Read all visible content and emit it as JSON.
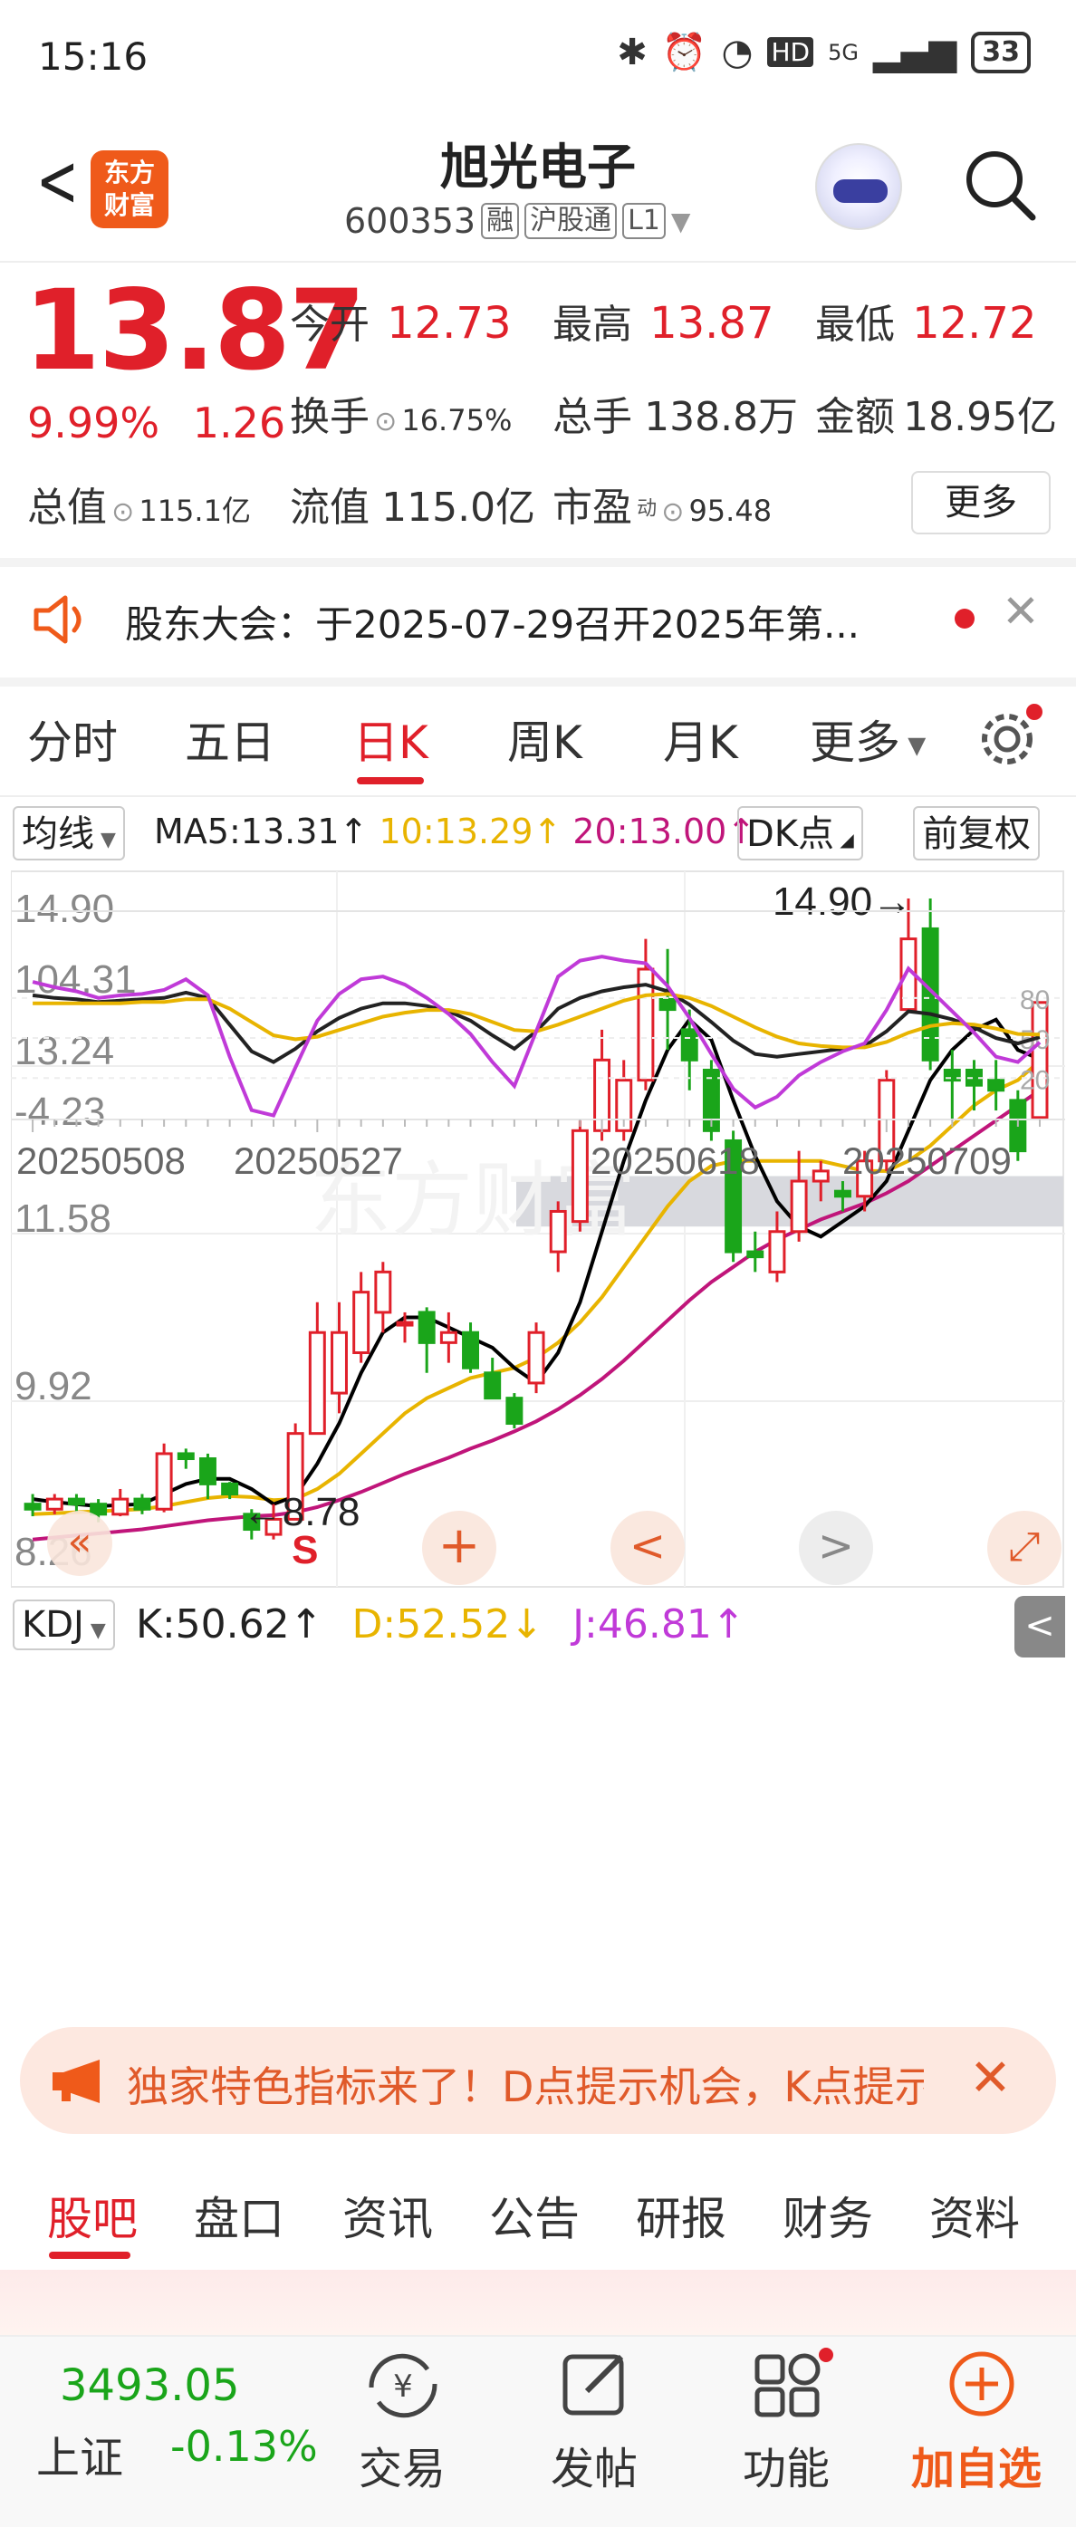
{
  "status": {
    "time": "15:16",
    "network": "5G",
    "hd": "HD",
    "battery": "33"
  },
  "header": {
    "title": "旭光电子",
    "code": "600353",
    "tags": [
      "融",
      "沪股通",
      "L1"
    ],
    "logo_lines": [
      "东方",
      "财富"
    ]
  },
  "quote": {
    "price": "13.87",
    "pct": "9.99%",
    "change": "1.26",
    "open_label": "今开",
    "open": "12.73",
    "high_label": "最高",
    "high": "13.87",
    "low_label": "最低",
    "low": "12.72",
    "turnover_label": "换手",
    "turnover": "16.75%",
    "volume_label": "总手",
    "volume": "138.8万",
    "amount_label": "金额",
    "amount": "18.95亿",
    "mktcap_label": "总值",
    "mktcap": "115.1亿",
    "float_label": "流值",
    "float": "115.0亿",
    "pe_label": "市盈",
    "pe_sup": "动",
    "pe": "95.48",
    "more": "更多"
  },
  "notice": {
    "text": "股东大会：于2025-07-29召开2025年第..."
  },
  "tabs": [
    "分时",
    "五日",
    "日K",
    "周K",
    "月K",
    "更多"
  ],
  "active_tab": "日K",
  "kline_bar": {
    "ma_btn": "均线",
    "ma5": "MA5:13.31↑",
    "ma10": "10:13.29↑",
    "ma20": "20:13.00↑",
    "dk": "DK点",
    "fq": "前复权"
  },
  "kdj_bar": {
    "btn": "KDJ",
    "k": "K:50.62↑",
    "d": "D:52.52↓",
    "j": "J:46.81↑"
  },
  "chart_data": [
    {
      "type": "candlestick",
      "y_labels": [
        "14.90",
        "13.24",
        "11.58",
        "9.92",
        "8.26"
      ],
      "ylim": [
        8.26,
        14.9
      ],
      "annotations": [
        "14.90",
        "8.78",
        "S"
      ],
      "x_labels": [
        "20250508",
        "20250527",
        "20250618",
        "20250709"
      ],
      "candles": [
        {
          "o": 8.9,
          "c": 8.85,
          "h": 9.0,
          "l": 8.78
        },
        {
          "o": 8.85,
          "c": 8.95,
          "h": 9.0,
          "l": 8.8
        },
        {
          "o": 8.95,
          "c": 8.9,
          "h": 9.0,
          "l": 8.82
        },
        {
          "o": 8.9,
          "c": 8.8,
          "h": 8.95,
          "l": 8.72
        },
        {
          "o": 8.8,
          "c": 8.95,
          "h": 9.05,
          "l": 8.78
        },
        {
          "o": 8.95,
          "c": 8.85,
          "h": 9.0,
          "l": 8.8
        },
        {
          "o": 8.85,
          "c": 9.4,
          "h": 9.5,
          "l": 8.82
        },
        {
          "o": 9.4,
          "c": 9.35,
          "h": 9.45,
          "l": 9.25
        },
        {
          "o": 9.35,
          "c": 9.1,
          "h": 9.4,
          "l": 8.95
        },
        {
          "o": 9.1,
          "c": 9.0,
          "h": 9.12,
          "l": 8.95
        },
        {
          "o": 8.8,
          "c": 8.65,
          "h": 8.85,
          "l": 8.55
        },
        {
          "o": 8.6,
          "c": 8.75,
          "h": 8.9,
          "l": 8.55
        },
        {
          "o": 8.75,
          "c": 9.6,
          "h": 9.7,
          "l": 8.75
        },
        {
          "o": 9.6,
          "c": 10.6,
          "h": 10.9,
          "l": 9.6
        },
        {
          "o": 10.0,
          "c": 10.6,
          "h": 10.9,
          "l": 9.8
        },
        {
          "o": 10.4,
          "c": 11.0,
          "h": 11.2,
          "l": 10.3
        },
        {
          "o": 10.8,
          "c": 11.2,
          "h": 11.3,
          "l": 10.6
        },
        {
          "o": 10.7,
          "c": 10.7,
          "h": 10.8,
          "l": 10.5
        },
        {
          "o": 10.8,
          "c": 10.5,
          "h": 10.85,
          "l": 10.2
        },
        {
          "o": 10.5,
          "c": 10.6,
          "h": 10.8,
          "l": 10.3
        },
        {
          "o": 10.6,
          "c": 10.25,
          "h": 10.7,
          "l": 10.2
        },
        {
          "o": 10.2,
          "c": 9.95,
          "h": 10.35,
          "l": 9.95
        },
        {
          "o": 9.95,
          "c": 9.7,
          "h": 10.0,
          "l": 9.65
        },
        {
          "o": 10.1,
          "c": 10.6,
          "h": 10.7,
          "l": 10.0
        },
        {
          "o": 11.4,
          "c": 11.8,
          "h": 11.9,
          "l": 11.2
        },
        {
          "o": 11.7,
          "c": 12.6,
          "h": 12.7,
          "l": 11.6
        },
        {
          "o": 12.6,
          "c": 13.3,
          "h": 13.6,
          "l": 12.5
        },
        {
          "o": 12.6,
          "c": 13.1,
          "h": 13.3,
          "l": 12.5
        },
        {
          "o": 13.1,
          "c": 14.2,
          "h": 14.5,
          "l": 13.0
        },
        {
          "o": 13.9,
          "c": 13.8,
          "h": 14.4,
          "l": 13.4
        },
        {
          "o": 13.6,
          "c": 13.3,
          "h": 13.8,
          "l": 13.0
        },
        {
          "o": 13.2,
          "c": 12.6,
          "h": 13.3,
          "l": 12.5
        },
        {
          "o": 12.5,
          "c": 11.4,
          "h": 12.6,
          "l": 11.3
        },
        {
          "o": 11.4,
          "c": 11.35,
          "h": 11.6,
          "l": 11.2
        },
        {
          "o": 11.2,
          "c": 11.6,
          "h": 11.8,
          "l": 11.1
        },
        {
          "o": 11.6,
          "c": 12.1,
          "h": 12.4,
          "l": 11.5
        },
        {
          "o": 12.1,
          "c": 12.2,
          "h": 12.3,
          "l": 11.9
        },
        {
          "o": 12.0,
          "c": 11.95,
          "h": 12.1,
          "l": 11.8
        },
        {
          "o": 11.95,
          "c": 12.3,
          "h": 12.4,
          "l": 11.8
        },
        {
          "o": 12.3,
          "c": 13.1,
          "h": 13.2,
          "l": 12.2
        },
        {
          "o": 13.8,
          "c": 14.5,
          "h": 14.9,
          "l": 13.8
        },
        {
          "o": 14.6,
          "c": 13.3,
          "h": 14.9,
          "l": 13.2
        },
        {
          "o": 13.2,
          "c": 13.1,
          "h": 13.4,
          "l": 12.7
        },
        {
          "o": 13.2,
          "c": 13.05,
          "h": 13.3,
          "l": 12.8
        },
        {
          "o": 13.1,
          "c": 13.0,
          "h": 13.3,
          "l": 12.8
        },
        {
          "o": 12.9,
          "c": 12.4,
          "h": 13.0,
          "l": 12.3
        },
        {
          "o": 12.73,
          "c": 13.87,
          "h": 13.87,
          "l": 12.72
        }
      ],
      "ma5": [
        8.95,
        8.92,
        8.9,
        8.88,
        8.89,
        8.9,
        9.0,
        9.1,
        9.15,
        9.15,
        9.05,
        8.9,
        8.98,
        9.3,
        9.7,
        10.2,
        10.6,
        10.75,
        10.75,
        10.65,
        10.55,
        10.45,
        10.25,
        10.1,
        10.4,
        10.9,
        11.6,
        12.3,
        12.9,
        13.4,
        13.7,
        13.5,
        12.9,
        12.35,
        11.9,
        11.65,
        11.55,
        11.7,
        11.85,
        12.1,
        12.6,
        13.1,
        13.4,
        13.6,
        13.7,
        13.4,
        13.31
      ],
      "ma10": [
        8.8,
        8.81,
        8.82,
        8.83,
        8.84,
        8.85,
        8.88,
        8.92,
        8.96,
        8.98,
        8.97,
        8.94,
        8.95,
        9.05,
        9.2,
        9.4,
        9.6,
        9.8,
        9.95,
        10.05,
        10.15,
        10.2,
        10.25,
        10.35,
        10.5,
        10.7,
        10.95,
        11.25,
        11.55,
        11.85,
        12.1,
        12.25,
        12.3,
        12.3,
        12.3,
        12.3,
        12.3,
        12.25,
        12.2,
        12.2,
        12.3,
        12.45,
        12.65,
        12.85,
        13.0,
        13.1,
        13.29
      ],
      "ma20": [
        8.55,
        8.57,
        8.59,
        8.61,
        8.63,
        8.65,
        8.68,
        8.71,
        8.74,
        8.76,
        8.78,
        8.79,
        8.82,
        8.87,
        8.94,
        9.02,
        9.11,
        9.2,
        9.28,
        9.36,
        9.45,
        9.53,
        9.62,
        9.72,
        9.84,
        9.98,
        10.14,
        10.32,
        10.52,
        10.72,
        10.92,
        11.1,
        11.25,
        11.4,
        11.52,
        11.62,
        11.72,
        11.8,
        11.88,
        11.98,
        12.1,
        12.25,
        12.4,
        12.55,
        12.7,
        12.85,
        13.0
      ],
      "zone": [
        11.65,
        12.15
      ]
    },
    {
      "type": "line",
      "y_labels": [
        "104.31",
        "-4.23"
      ],
      "right_labels": [
        "80",
        "50",
        "20"
      ],
      "ylim": [
        -4.23,
        104.31
      ],
      "series": [
        {
          "name": "K",
          "values": [
            82,
            80,
            79,
            77,
            78,
            79,
            80,
            84,
            80,
            60,
            40,
            32,
            42,
            55,
            65,
            72,
            76,
            76,
            74,
            70,
            63,
            52,
            42,
            55,
            72,
            80,
            85,
            88,
            90,
            85,
            75,
            62,
            48,
            38,
            36,
            38,
            40,
            42,
            44,
            55,
            70,
            68,
            64,
            58,
            50,
            46,
            50.62
          ]
        },
        {
          "name": "D",
          "values": [
            76,
            76,
            76,
            76,
            76,
            77,
            77,
            79,
            79,
            72,
            62,
            52,
            49,
            51,
            56,
            61,
            66,
            69,
            71,
            71,
            68,
            62,
            56,
            55,
            60,
            66,
            72,
            78,
            82,
            83,
            80,
            74,
            66,
            58,
            51,
            46,
            44,
            43,
            43,
            47,
            54,
            59,
            61,
            60,
            57,
            53,
            52.52
          ]
        },
        {
          "name": "J",
          "values": [
            92,
            88,
            85,
            80,
            82,
            83,
            86,
            94,
            82,
            36,
            -4,
            -8,
            28,
            63,
            83,
            94,
            96,
            90,
            80,
            68,
            53,
            32,
            14,
            55,
            96,
            108,
            111,
            108,
            106,
            89,
            65,
            38,
            12,
            -2,
            6,
            22,
            32,
            40,
            46,
            71,
            102,
            86,
            70,
            54,
            36,
            32,
            46.81
          ]
        }
      ]
    }
  ],
  "banner": {
    "text": "独家特色指标来了！D点提示机会，K点提示"
  },
  "bottom_tabs": [
    "股吧",
    "盘口",
    "资讯",
    "公告",
    "研报",
    "财务",
    "资料"
  ],
  "index": {
    "value": "3493.05",
    "name": "上证",
    "pct": "-0.13%"
  },
  "bottom_nav": [
    "交易",
    "发帖",
    "功能",
    "加自选"
  ],
  "colors": {
    "up": "#e0202a",
    "down": "#1aa51a",
    "ma5": "#000000",
    "ma10": "#e8b400",
    "ma20": "#c0157a"
  }
}
